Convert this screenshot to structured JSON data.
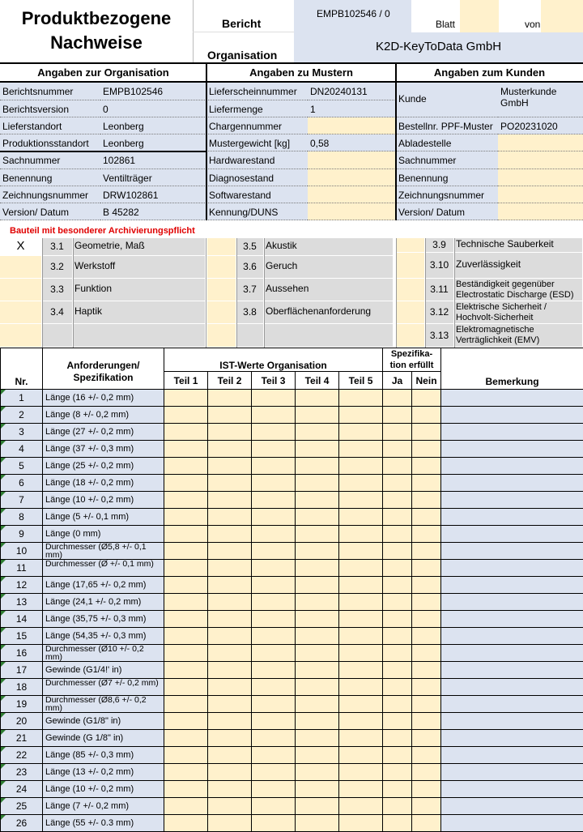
{
  "header": {
    "title_line1": "Produktbezogene",
    "title_line2": "Nachweise",
    "bericht_label": "Bericht",
    "organisation_label": "Organisation",
    "report_id": "EMPB102546 / 0",
    "blatt_label": "Blatt",
    "von_label": "von",
    "company": "K2D-KeyToData GmbH"
  },
  "sections": {
    "org": "Angaben zur Organisation",
    "muster": "Angaben zu Mustern",
    "kunde": "Angaben zum Kunden"
  },
  "org_rows": [
    {
      "label": "Berichtsnummer",
      "value": "EMPB102546"
    },
    {
      "label": "Berichtsversion",
      "value": "0"
    },
    {
      "label": "Lieferstandort",
      "value": "Leonberg"
    },
    {
      "label": "Produktionsstandort",
      "value": "Leonberg"
    },
    {
      "label": "Sachnummer",
      "value": "102861"
    },
    {
      "label": "Benennung",
      "value": "Ventilträger"
    },
    {
      "label": "Zeichnungsnummer",
      "value": "DRW102861"
    },
    {
      "label": "Version/ Datum",
      "value": "B 45282"
    }
  ],
  "muster_rows": [
    {
      "label": "Lieferscheinnummer",
      "value": "DN20240131"
    },
    {
      "label": "Liefermenge",
      "value": "1"
    },
    {
      "label": "Chargennummer",
      "value": ""
    },
    {
      "label": "Mustergewicht [kg]",
      "value": "0,58"
    },
    {
      "label": "Hardwarestand",
      "value": ""
    },
    {
      "label": "Diagnosestand",
      "value": ""
    },
    {
      "label": "Softwarestand",
      "value": ""
    },
    {
      "label": "Kennung/DUNS",
      "value": ""
    }
  ],
  "kunde_rows": [
    {
      "label": "Kunde",
      "value": "Musterkunde GmbH"
    },
    {
      "label": "Bestellnr. PPF-Muster",
      "value": "PO20231020"
    },
    {
      "label": "Abladestelle",
      "value": ""
    },
    {
      "label": "Sachnummer",
      "value": ""
    },
    {
      "label": "Benennung",
      "value": ""
    },
    {
      "label": "Zeichnungsnummer",
      "value": ""
    },
    {
      "label": "Version/ Datum",
      "value": ""
    }
  ],
  "archive_note": "Bauteil mit besonderer Archivierungspflicht",
  "checks": {
    "col1": [
      {
        "mark": "X",
        "num": "3.1",
        "label": "Geometrie, Maß"
      },
      {
        "mark": "",
        "num": "3.2",
        "label": "Werkstoff"
      },
      {
        "mark": "",
        "num": "3.3",
        "label": "Funktion"
      },
      {
        "mark": "",
        "num": "3.4",
        "label": "Haptik"
      }
    ],
    "col2": [
      {
        "mark": "",
        "num": "3.5",
        "label": "Akustik"
      },
      {
        "mark": "",
        "num": "3.6",
        "label": "Geruch"
      },
      {
        "mark": "",
        "num": "3.7",
        "label": "Aussehen"
      },
      {
        "mark": "",
        "num": "3.8",
        "label": "Oberflächenanforderung"
      }
    ],
    "col3": [
      {
        "mark": "",
        "num": "3.9",
        "label": "Technische Sauberkeit"
      },
      {
        "mark": "",
        "num": "3.10",
        "label": "Zuverlässigkeit"
      },
      {
        "mark": "",
        "num": "3.11",
        "label": "Beständigkeit gegenüber Electrostatic Discharge (ESD)"
      },
      {
        "mark": "",
        "num": "3.12",
        "label": "Elektrische Sicherheit / Hochvolt-Sicherheit"
      },
      {
        "mark": "",
        "num": "3.13",
        "label": "Elektromagnetische Verträglichkeit (EMV)"
      }
    ]
  },
  "table_headers": {
    "nr": "Nr.",
    "req_line1": "Anforderungen/",
    "req_line2": "Spezifikation",
    "ist": "IST-Werte Organisation",
    "teil1": "Teil 1",
    "teil2": "Teil 2",
    "teil3": "Teil 3",
    "teil4": "Teil 4",
    "teil5": "Teil 5",
    "spez_line1": "Spezifika-",
    "spez_line2": "tion erfüllt",
    "ja": "Ja",
    "nein": "Nein",
    "bemerkung": "Bemerkung"
  },
  "requirements": [
    {
      "nr": "1",
      "spec": "Länge (16 +/- 0,2 mm)"
    },
    {
      "nr": "2",
      "spec": "Länge (8 +/- 0,2 mm)"
    },
    {
      "nr": "3",
      "spec": "Länge (27 +/- 0,2 mm)"
    },
    {
      "nr": "4",
      "spec": "Länge (37 +/- 0,3 mm)"
    },
    {
      "nr": "5",
      "spec": "Länge (25 +/- 0,2 mm)"
    },
    {
      "nr": "6",
      "spec": "Länge (18 +/- 0,2 mm)"
    },
    {
      "nr": "7",
      "spec": "Länge (10 +/- 0,2 mm)"
    },
    {
      "nr": "8",
      "spec": "Länge (5 +/- 0,1 mm)"
    },
    {
      "nr": "9",
      "spec": "Länge (0  mm)"
    },
    {
      "nr": "10",
      "spec": "Durchmesser (Ø5,8 +/- 0,1 mm)"
    },
    {
      "nr": "11",
      "spec": "Durchmesser (Ø +/- 0,1 mm)"
    },
    {
      "nr": "12",
      "spec": "Länge (17,65 +/- 0,2 mm)"
    },
    {
      "nr": "13",
      "spec": "Länge (24,1 +/- 0,2 mm)"
    },
    {
      "nr": "14",
      "spec": "Länge (35,75 +/- 0,3 mm)"
    },
    {
      "nr": "15",
      "spec": "Länge (54,35 +/- 0,3 mm)"
    },
    {
      "nr": "16",
      "spec": "Durchmesser (Ø10 +/- 0,2 mm)"
    },
    {
      "nr": "17",
      "spec": "Gewinde (G1/4!' in)"
    },
    {
      "nr": "18",
      "spec": "Durchmesser (Ø7 +/- 0,2 mm)"
    },
    {
      "nr": "19",
      "spec": "Durchmesser (Ø8,6 +/- 0,2 mm)"
    },
    {
      "nr": "20",
      "spec": "Gewinde (G1/8\" in)"
    },
    {
      "nr": "21",
      "spec": "Gewinde (G 1/8\" in)"
    },
    {
      "nr": "22",
      "spec": "Länge (85 +/- 0,3 mm)"
    },
    {
      "nr": "23",
      "spec": "Länge (13 +/- 0,2 mm)"
    },
    {
      "nr": "24",
      "spec": "Länge (10 +/- 0,2 mm)"
    },
    {
      "nr": "25",
      "spec": "Länge (7 +/- 0,2 mm)"
    },
    {
      "nr": "26",
      "spec": "Länge (55 +/- 0.3 mm)"
    }
  ]
}
